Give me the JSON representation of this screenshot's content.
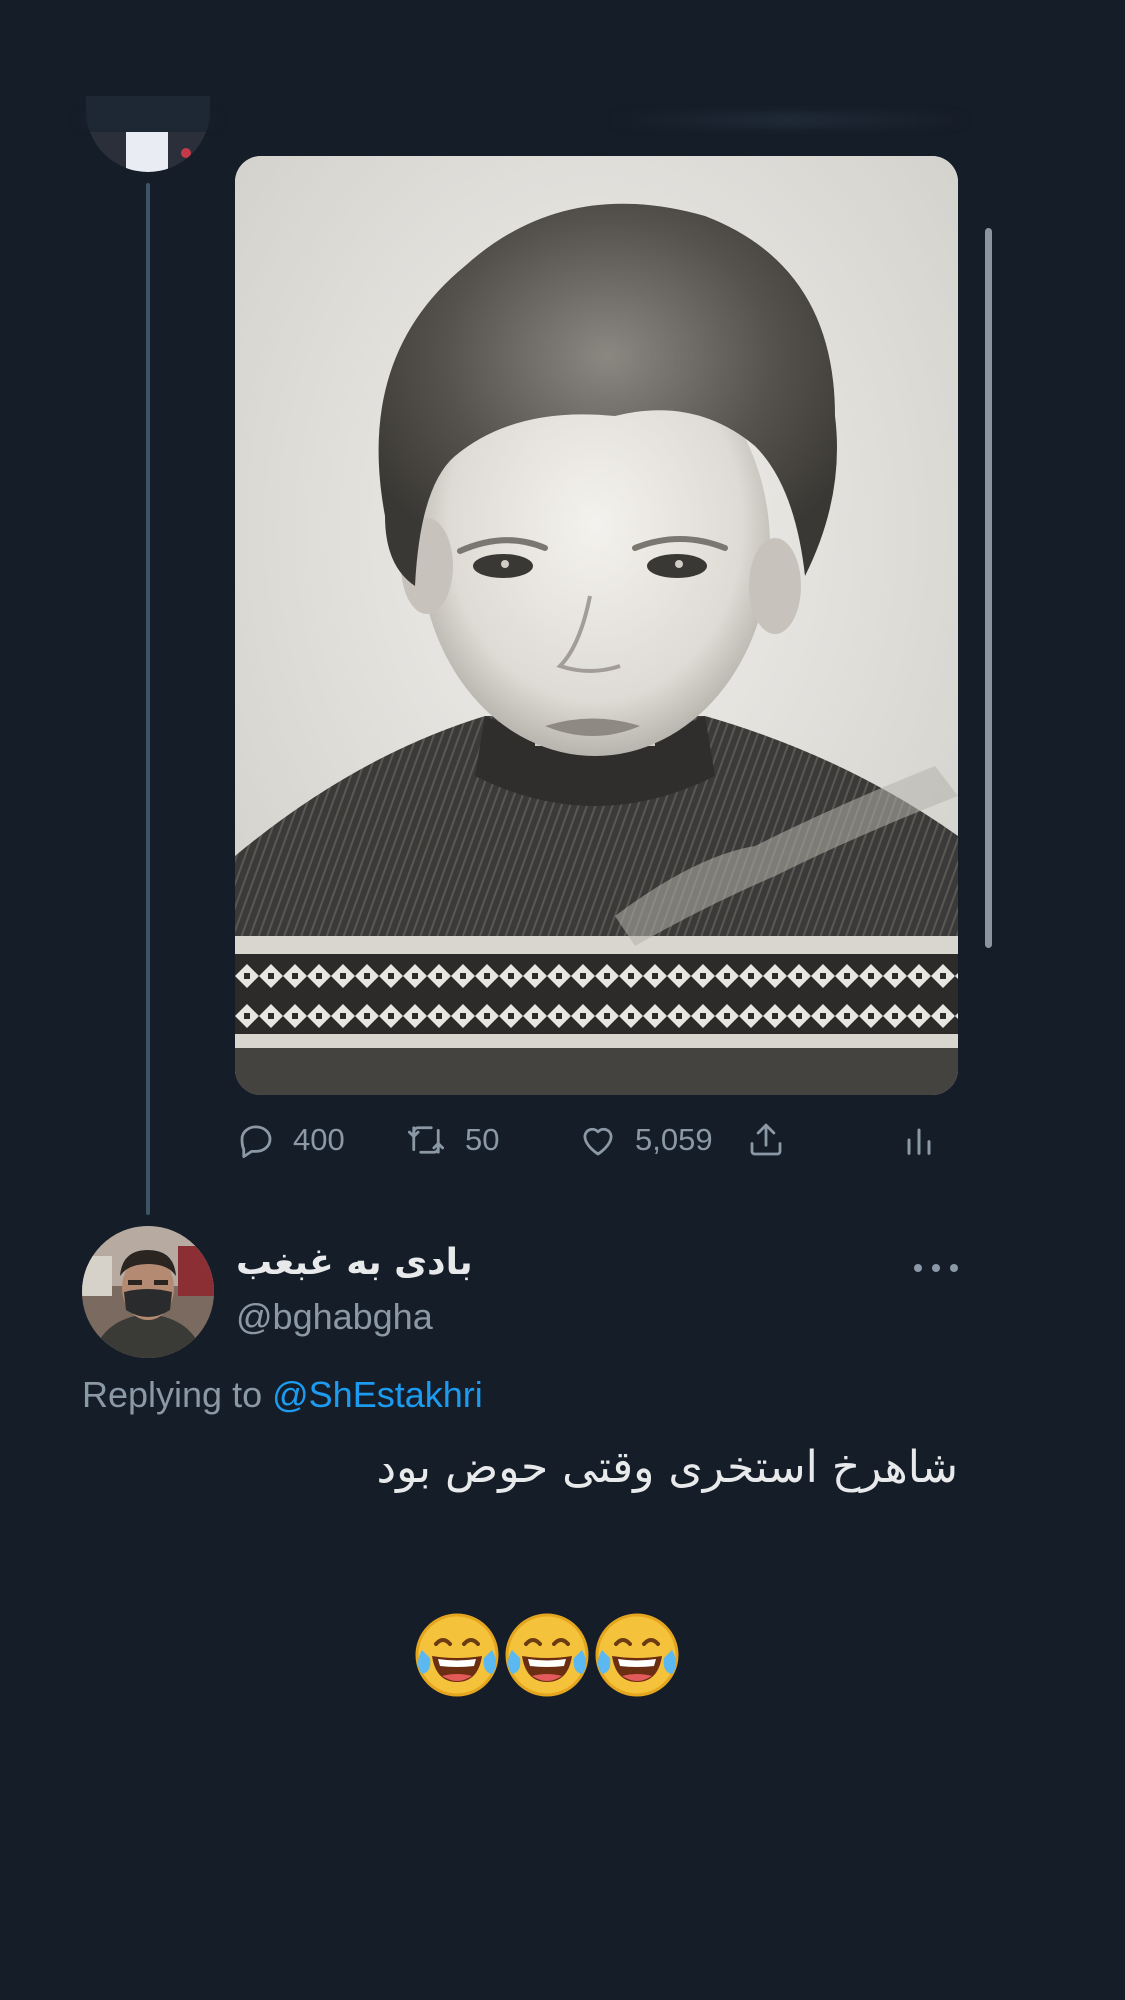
{
  "original_tweet": {
    "image_alt": "vintage black and white childhood portrait of a boy in a patterned sweater",
    "stats": {
      "replies": "400",
      "retweets": "50",
      "likes": "5,059"
    },
    "icons": [
      "reply-icon",
      "retweet-icon",
      "like-icon",
      "share-icon",
      "analytics-icon"
    ]
  },
  "reply_tweet": {
    "display_name": "بادی به غبغب",
    "handle": "@bghabgha",
    "replying_prefix": "Replying to ",
    "replying_mention": "@ShEstakhri",
    "text": "شاهرخ استخری وقتی حوض بود",
    "emoji_count": 3
  },
  "colors": {
    "background": "#151d28",
    "text_primary": "#e7e9ea",
    "text_secondary": "#8b98a5",
    "link": "#1d9bf0",
    "thread_line": "#3d5466"
  }
}
